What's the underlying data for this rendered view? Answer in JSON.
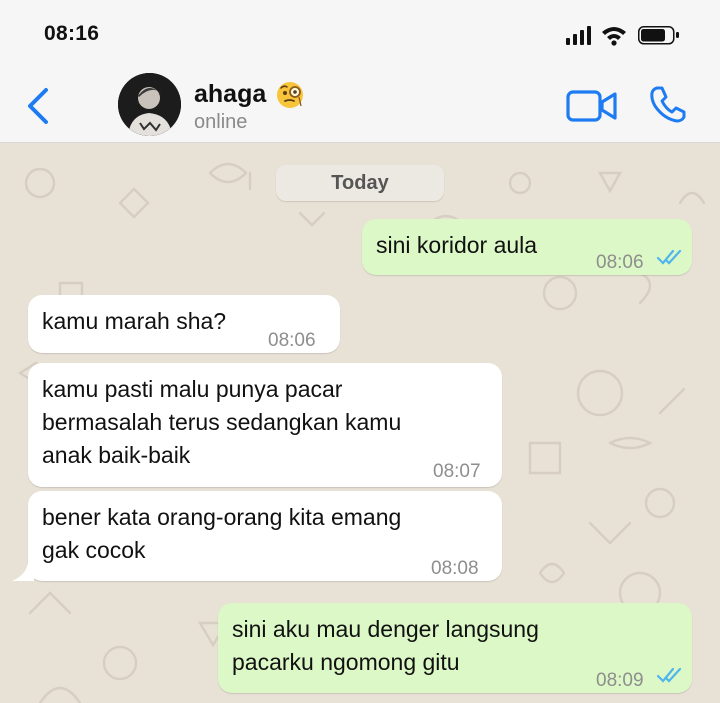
{
  "status_bar": {
    "time": "08:16"
  },
  "header": {
    "contact_name": "ahaga",
    "contact_status": "online",
    "icons": [
      "back-chevron-icon",
      "video-call-icon",
      "phone-call-icon",
      "signal-icon",
      "wifi-icon",
      "battery-icon",
      "face-with-monocle-emoji"
    ]
  },
  "date_label": "Today",
  "messages": [
    {
      "direction": "out",
      "lines": [
        "sini koridor aula"
      ],
      "time": "08:06",
      "status": "read"
    },
    {
      "direction": "in",
      "lines": [
        "kamu marah sha?"
      ],
      "time": "08:06"
    },
    {
      "direction": "in",
      "lines": [
        "kamu pasti malu punya pacar",
        "bermasalah terus sedangkan kamu",
        "anak baik-baik"
      ],
      "time": "08:07"
    },
    {
      "direction": "in",
      "lines": [
        "bener kata orang-orang kita emang",
        "gak cocok"
      ],
      "time": "08:08"
    },
    {
      "direction": "out",
      "lines": [
        "sini aku mau denger langsung",
        "pacarku ngomong gitu"
      ],
      "time": "08:09",
      "status": "read"
    }
  ],
  "colors": {
    "accent_blue": "#1d7cf2",
    "outgoing_bubble": "#dcf8c6",
    "incoming_bubble": "#ffffff",
    "read_ticks": "#4fb6ec",
    "chat_background": "#e8e1d6"
  }
}
